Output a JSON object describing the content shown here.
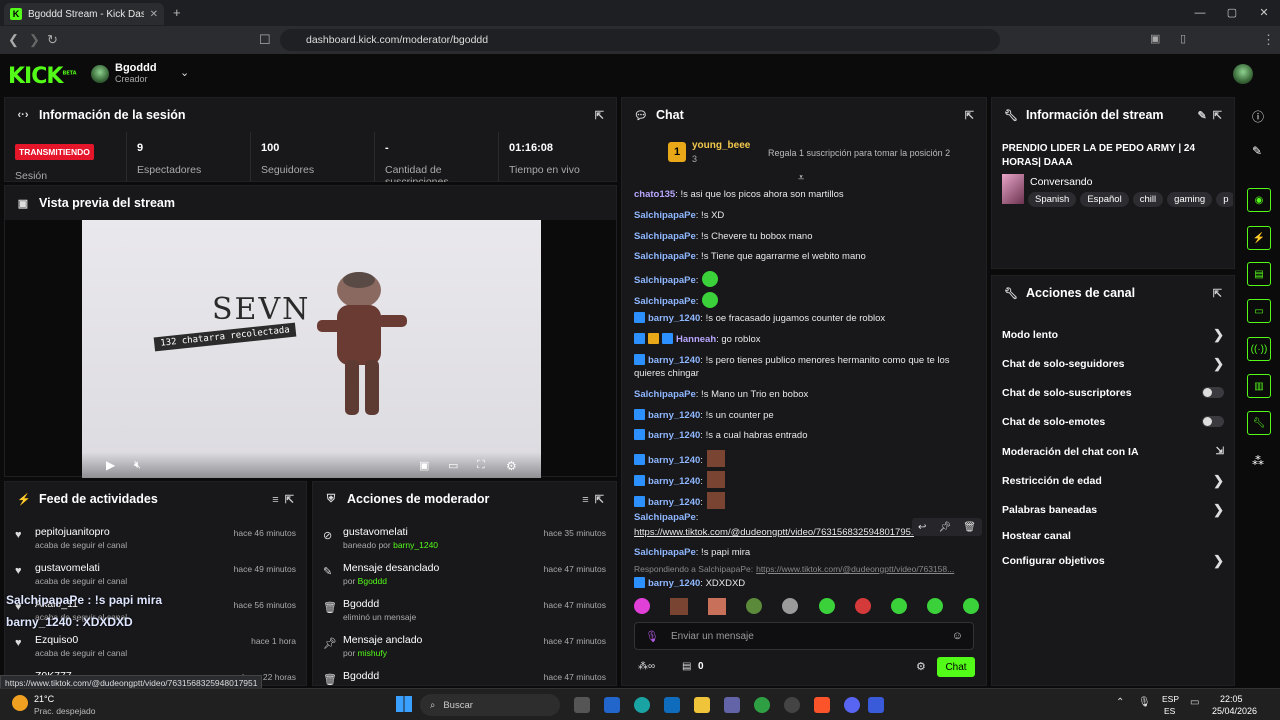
{
  "browser": {
    "tab_title": "Bgoddd Stream - Kick Dashboard",
    "url": "dashboard.kick.com/moderator/bgoddd",
    "status_url": "https://www.tiktok.com/@dudeongptt/video/7631568325948017951"
  },
  "header": {
    "logo": "KICK",
    "logo_sup": "BETA",
    "user": "Bgoddd",
    "role": "Creador"
  },
  "session": {
    "title": "Información de la sesión",
    "status": "TRANSMITIENDO",
    "status_label": "Sesión",
    "viewers": "9",
    "viewers_label": "Espectadores",
    "followers": "100",
    "followers_label": "Seguidores",
    "subs": "-",
    "subs_label": "Cantidad de suscripciones",
    "live_time": "01:16:08",
    "live_label": "Tiempo en vivo"
  },
  "preview": {
    "title": "Vista previa del stream",
    "overlay_title": "SEVN",
    "overlay_sub": "132 chatarra recolectada"
  },
  "feed": {
    "title": "Feed de actividades",
    "items": [
      {
        "name": "pepitojuanitopro",
        "sub": "acaba de seguir el canal",
        "time": "hace 46 minutos"
      },
      {
        "name": "gustavomelati",
        "sub": "acaba de seguir el canal",
        "time": "hace 49 minutos"
      },
      {
        "name": "Akaio_11",
        "sub": "acaba de seguir el canal",
        "time": "hace 56 minutos"
      },
      {
        "name": "Ezquiso0",
        "sub": "acaba de seguir el canal",
        "time": "hace 1 hora"
      },
      {
        "name": "Z0K777",
        "sub": "",
        "time": "hace 22 horas"
      }
    ]
  },
  "overlay_chat": {
    "l1": "SalchipapaPe : !s papi mira",
    "l2": "barny_1240 : XDXDXD"
  },
  "modactions": {
    "title": "Acciones de moderador",
    "items": [
      {
        "name": "gustavomelati",
        "sub": "baneado por",
        "by": "barny_1240",
        "time": "hace 35 minutos"
      },
      {
        "name": "Mensaje desanclado",
        "sub": "por",
        "by": "Bgoddd",
        "time": "hace 47 minutos"
      },
      {
        "name": "Bgoddd",
        "sub": "eliminó un mensaje",
        "by": "",
        "time": "hace 47 minutos"
      },
      {
        "name": "Mensaje anclado",
        "sub": "por",
        "by": "mishufy",
        "time": "hace 47 minutos"
      },
      {
        "name": "Bgoddd",
        "sub": "",
        "by": "",
        "time": "hace 47 minutos"
      }
    ]
  },
  "chat": {
    "title": "Chat",
    "pinned_user": "young_beee",
    "pinned_count": "3",
    "gift_text": "Regala 1 suscripción para tomar la posición 2",
    "rank": "1",
    "messages": [
      {
        "user": "chato135",
        "text": ": !s asi que los picos ahora son martillos"
      },
      {
        "user": "SalchipapaPe",
        "text": ": !s XD"
      },
      {
        "user": "SalchipapaPe",
        "text": ": !s Chevere tu bobox mano"
      },
      {
        "user": "SalchipapaPe",
        "text": ": !s Tiene que agarrarme el webito mano"
      },
      {
        "user": "SalchipapaPe",
        "text": ":"
      },
      {
        "user": "SalchipapaPe",
        "text": ":"
      },
      {
        "user": "barny_1240",
        "text": ": !s oe fracasado jugamos counter de roblox"
      },
      {
        "user": "Hanneah",
        "text": ": go roblox"
      },
      {
        "user": "barny_1240",
        "text": ": !s pero tienes publico menores hermanito como que te los quieres chingar"
      },
      {
        "user": "SalchipapaPe",
        "text": ": !s Mano un Trio en bobox"
      },
      {
        "user": "barny_1240",
        "text": ": !s un counter pe"
      },
      {
        "user": "barny_1240",
        "text": ": !s a cual habras entrado"
      },
      {
        "user": "barny_1240",
        "text": ":"
      },
      {
        "user": "barny_1240",
        "text": ":"
      },
      {
        "user": "barny_1240",
        "text": ":"
      },
      {
        "user": "SalchipapaPe",
        "text": ":"
      },
      {
        "user": "SalchipapaPe",
        "text": ": !s papi mira"
      },
      {
        "user": "barny_1240",
        "text": ": XDXDXD"
      }
    ],
    "link": "https://www.tiktok.com/@dudeongptt/video/7631568325948017951",
    "reply_text": "Respondiendo a SalchipapaPe:",
    "reply_link": "https://www.tiktok.com/@dudeongptt/video/763158...",
    "input_placeholder": "Enviar un mensaje",
    "cart_count": "0",
    "send": "Chat"
  },
  "stream_info": {
    "title": "Información del stream",
    "stream_title": "PRENDIO LIDER LA DE PEDO ARMY | 24 HORAS| DAAA",
    "category": "Conversando",
    "tags": [
      "Spanish",
      "Español",
      "chill",
      "gaming",
      "p"
    ]
  },
  "channel_actions": {
    "title": "Acciones de canal",
    "items": [
      "Modo lento",
      "Chat de solo-seguidores",
      "Chat de solo-suscriptores",
      "Chat de solo-emotes",
      "Moderación del chat con IA",
      "Restricción de edad",
      "Palabras baneadas",
      "Hostear canal",
      "Configurar objetivos"
    ]
  },
  "taskbar": {
    "temp": "21°C",
    "weather": "Prac. despejado",
    "search": "Buscar",
    "lang1": "ESP",
    "lang2": "ES",
    "time": "22:05",
    "date": "25/04/2026"
  }
}
